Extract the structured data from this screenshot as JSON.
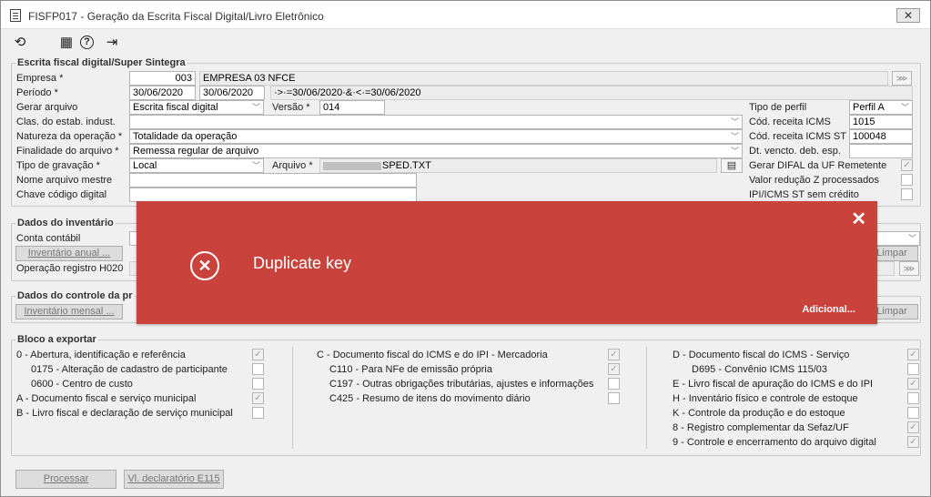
{
  "window": {
    "title": "FISFP017 - Geração da Escrita Fiscal Digital/Livro Eletrônico",
    "close": "✕"
  },
  "toolbar": {
    "icons": [
      "refresh-icon",
      "calculator-icon",
      "help-icon",
      "exit-icon"
    ],
    "glyphs": [
      "⟲",
      "▦",
      "?",
      "⇥"
    ]
  },
  "escrita": {
    "title": "Escrita fiscal digital/Super Sintegra",
    "empresa_label": "Empresa *",
    "empresa_code": "003",
    "empresa_name": "EMPRESA 03 NFCE",
    "periodo_label": "Período *",
    "periodo_start": "30/06/2020",
    "periodo_end": "30/06/2020",
    "periodo_expr": "·>·=30/06/2020·&·<·=30/06/2020",
    "gerar_label": "Gerar arquivo",
    "gerar_value": "Escrita fiscal digital",
    "versao_label": "Versão *",
    "versao_value": "014",
    "clas_label": "Clas. do estab. indust.",
    "clas_value": "",
    "natureza_label": "Natureza da operação *",
    "natureza_value": "Totalidade da operação",
    "finalidade_label": "Finalidade do arquivo *",
    "finalidade_value": "Remessa regular de arquivo",
    "tipo_grav_label": "Tipo de gravação *",
    "tipo_grav_value": "Local",
    "arquivo_label": "Arquivo *",
    "arquivo_value": "SPED.TXT",
    "nome_label": "Nome arquivo mestre",
    "chave_label": "Chave código digital",
    "tipo_perfil_label": "Tipo de perfil",
    "tipo_perfil_value": "Perfil A",
    "cod_icms_label": "Cód. receita ICMS",
    "cod_icms_value": "1015",
    "cod_icms_st_label": "Cód. receita ICMS ST",
    "cod_icms_st_value": "100048",
    "dt_vencto_label": "Dt. vencto. deb. esp.",
    "dt_vencto_value": "",
    "difal_label": "Gerar DIFAL da UF Remetente",
    "difal_checked": true,
    "reducao_label": "Valor redução Z processados",
    "reducao_checked": false,
    "ipi_label": "IPI/ICMS ST sem crédito",
    "ipi_checked": false
  },
  "inventario": {
    "title": "Dados do inventário",
    "conta_label": "Conta contábil",
    "anual_button": "Inventário anual ...",
    "limpar_button": "Limpar",
    "operacao_label": "Operação registro H020"
  },
  "controle": {
    "title": "Dados do controle da pr",
    "mensal_button": "Inventário mensal ...",
    "limpar_button": "Limpar"
  },
  "bloco": {
    "title": "Bloco a exportar",
    "col1": [
      {
        "label": "0 - Abertura, identificação e referência",
        "checked": true,
        "indent": false
      },
      {
        "label": "0175 - Alteração de cadastro de participante",
        "checked": false,
        "indent": true
      },
      {
        "label": "0600 - Centro de custo",
        "checked": false,
        "indent": true
      },
      {
        "label": "A - Documento fiscal e serviço municipal",
        "checked": true,
        "indent": false
      },
      {
        "label": "B - Livro fiscal e declaração de serviço municipal",
        "checked": false,
        "indent": false
      }
    ],
    "col2": [
      {
        "label": "C - Documento fiscal do ICMS e do IPI - Mercadoria",
        "checked": true,
        "indent": false
      },
      {
        "label": "C110 - Para NFe de emissão própria",
        "checked": true,
        "indent": true
      },
      {
        "label": "C197 - Outras obrigações tributárias, ajustes e informações",
        "checked": false,
        "indent": true
      },
      {
        "label": "C425 - Resumo de itens do movimento diário",
        "checked": false,
        "indent": true
      }
    ],
    "col3": [
      {
        "label": "D - Documento fiscal do ICMS - Serviço",
        "checked": true,
        "indent": false
      },
      {
        "label": "D695 - Convênio ICMS 115/03",
        "checked": false,
        "indent": true
      },
      {
        "label": "E - Livro fiscal de apuração do ICMS e do IPI",
        "checked": true,
        "indent": false
      },
      {
        "label": "H - Inventário físico e controle de estoque",
        "checked": false,
        "indent": false
      },
      {
        "label": "K - Controle da produção e do estoque",
        "checked": false,
        "indent": false
      },
      {
        "label": "8 - Registro complementar da Sefaz/UF",
        "checked": true,
        "indent": false
      },
      {
        "label": "9 - Controle e encerramento do arquivo digital",
        "checked": true,
        "indent": false
      }
    ]
  },
  "footer": {
    "processar": "Processar",
    "declaratorio": "Vl. declaratório E115"
  },
  "toast": {
    "message": "Duplicate key",
    "more": "Adicional...",
    "close": "✕",
    "icon": "✕"
  },
  "colors": {
    "toast_bg": "#c9423c",
    "window_bg": "#f0f0f0"
  }
}
